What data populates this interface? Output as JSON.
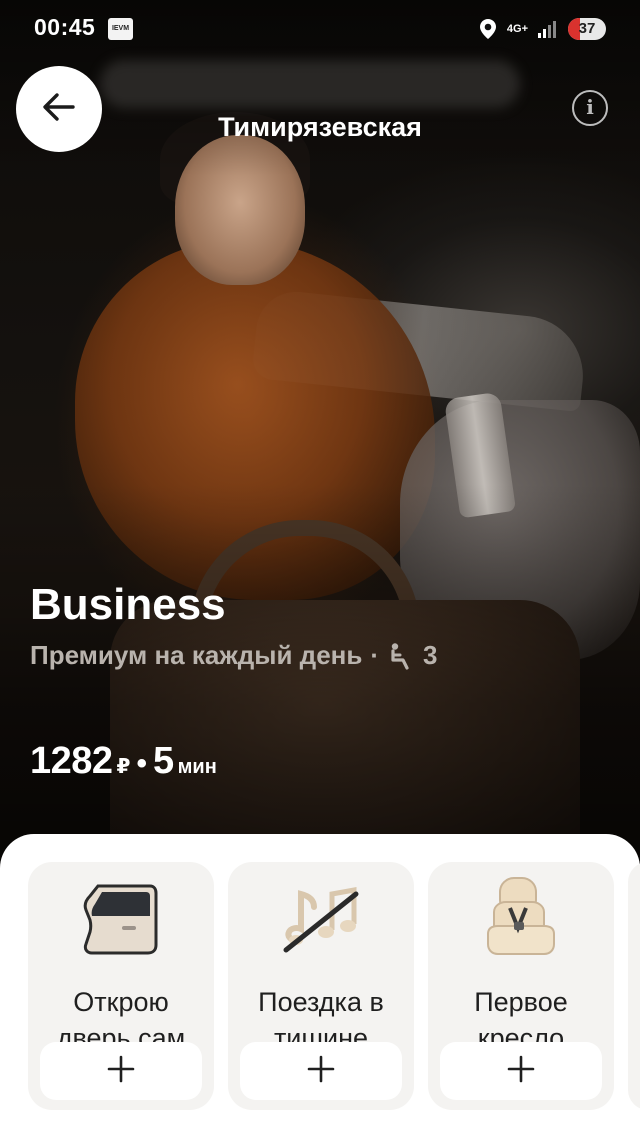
{
  "status_bar": {
    "time": "00:45",
    "app_icon_text": "IEVM",
    "network": "4G+",
    "battery": "37",
    "icons": [
      "location-icon",
      "signal-icon",
      "battery-icon"
    ]
  },
  "header": {
    "title": "Тимирязевская",
    "back_icon": "arrow-left-icon",
    "info_label": "i"
  },
  "tariff": {
    "name": "Business",
    "subtitle": "Премиум на каждый день",
    "separator": "·",
    "seats": "3",
    "price": "1282",
    "currency": "₽",
    "eta_value": "5",
    "eta_unit": "мин",
    "dot": "•"
  },
  "options": [
    {
      "title_line1": "Открою",
      "title_line2": "дверь сам",
      "icon": "car-door-icon",
      "add_label": "+"
    },
    {
      "title_line1": "Поездка в",
      "title_line2": "тишине",
      "icon": "music-off-icon",
      "add_label": "+"
    },
    {
      "title_line1": "Первое",
      "title_line2": "кресло",
      "icon": "child-seat-icon",
      "add_label": "+"
    }
  ],
  "colors": {
    "accent_white": "#ffffff",
    "card_bg": "#f4f3f1",
    "battery_red": "#d9322e",
    "subtitle_gray": "#b9b3ad"
  }
}
